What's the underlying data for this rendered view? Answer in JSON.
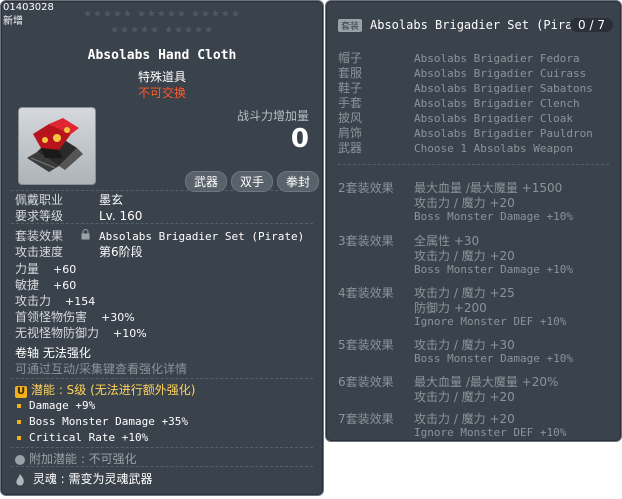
{
  "item": {
    "id": "01403028",
    "tag": "新增",
    "stars_row1": "★★★★★ ★★★★★ ★★★★★",
    "stars_row2": "★★★★★ ★★★★★",
    "name": "Absolabs Hand Cloth",
    "type": "特殊道具",
    "trade": "不可交换",
    "cp_label": "战斗力增加量",
    "cp_value": "0",
    "job_tags": [
      "武器",
      "双手",
      "拳封"
    ]
  },
  "stats": {
    "job_label": "佩戴职业",
    "job_value": "墨玄",
    "level_label": "要求等级",
    "level_value": "Lv. 160",
    "set_label": "套装效果",
    "set_value": "Absolabs Brigadier Set (Pirate)",
    "speed_label": "攻击速度",
    "speed_value": "第6阶段",
    "str_label": "力量",
    "str_value": "+60",
    "dex_label": "敏捷",
    "dex_value": "+60",
    "att_label": "攻击力",
    "att_value": "+154",
    "boss_label": "首领怪物伤害",
    "boss_value": "+30%",
    "ied_label": "无视怪物防御力",
    "ied_value": "+10%",
    "scroll_text": "卷轴 无法强化",
    "hint_text": "可通过互动/采集键查看强化详情"
  },
  "potential": {
    "badge": "U",
    "title": "潜能 : S级 (无法进行额外强化)",
    "lines": [
      "Damage +9%",
      "Boss Monster Damage +35%",
      "Critical Rate +10%"
    ]
  },
  "bonus": {
    "text": "附加潜能 : 不可强化"
  },
  "soul": {
    "text": "灵魂 : 需变为灵魂武器"
  },
  "set": {
    "tag": "套装",
    "title": "Absolabs Brigadier Set (Pirate)",
    "count": "0 / 7",
    "pieces": [
      {
        "slot": "帽子",
        "name": "Absolabs Brigadier Fedora"
      },
      {
        "slot": "套服",
        "name": "Absolabs Brigadier Cuirass"
      },
      {
        "slot": "鞋子",
        "name": "Absolabs Brigadier Sabatons"
      },
      {
        "slot": "手套",
        "name": "Absolabs Brigadier Clench"
      },
      {
        "slot": "披风",
        "name": "Absolabs Brigadier Cloak"
      },
      {
        "slot": "肩饰",
        "name": "Absolabs Brigadier Pauldron"
      },
      {
        "slot": "武器",
        "name": "Choose 1 Absolabs Weapon"
      }
    ],
    "bonuses": [
      {
        "label": "2套装效果",
        "lines": [
          "最大血量 /最大魔量  +1500",
          "攻击力 / 魔力  +20",
          "Boss Monster Damage +10%"
        ]
      },
      {
        "label": "3套装效果",
        "lines": [
          "全属性  +30",
          "攻击力 / 魔力  +20",
          "Boss Monster Damage +10%"
        ]
      },
      {
        "label": "4套装效果",
        "lines": [
          "攻击力 / 魔力  +25",
          "防御力  +200",
          "Ignore Monster DEF +10%"
        ]
      },
      {
        "label": "5套装效果",
        "lines": [
          "攻击力 / 魔力  +30",
          "Boss Monster Damage +10%"
        ]
      },
      {
        "label": "6套装效果",
        "lines": [
          "最大血量 /最大魔量  +20%",
          "攻击力 / 魔力  +20"
        ]
      },
      {
        "label": "7套装效果",
        "lines": [
          "攻击力 / 魔力  +20",
          "Ignore Monster DEF +10%"
        ]
      }
    ]
  },
  "colors": {
    "panel": "#3a424c",
    "trade_red": "#ff5a2a",
    "potential_gold": "#f3b01a",
    "set_gray": "#8c939a"
  },
  "icons": {
    "item_icon": "red-black-glove-icon",
    "lock_icon": "lock-icon",
    "potential_icon": "unique-badge-icon",
    "bonus_icon": "circle-icon",
    "soul_icon": "flame-icon"
  }
}
